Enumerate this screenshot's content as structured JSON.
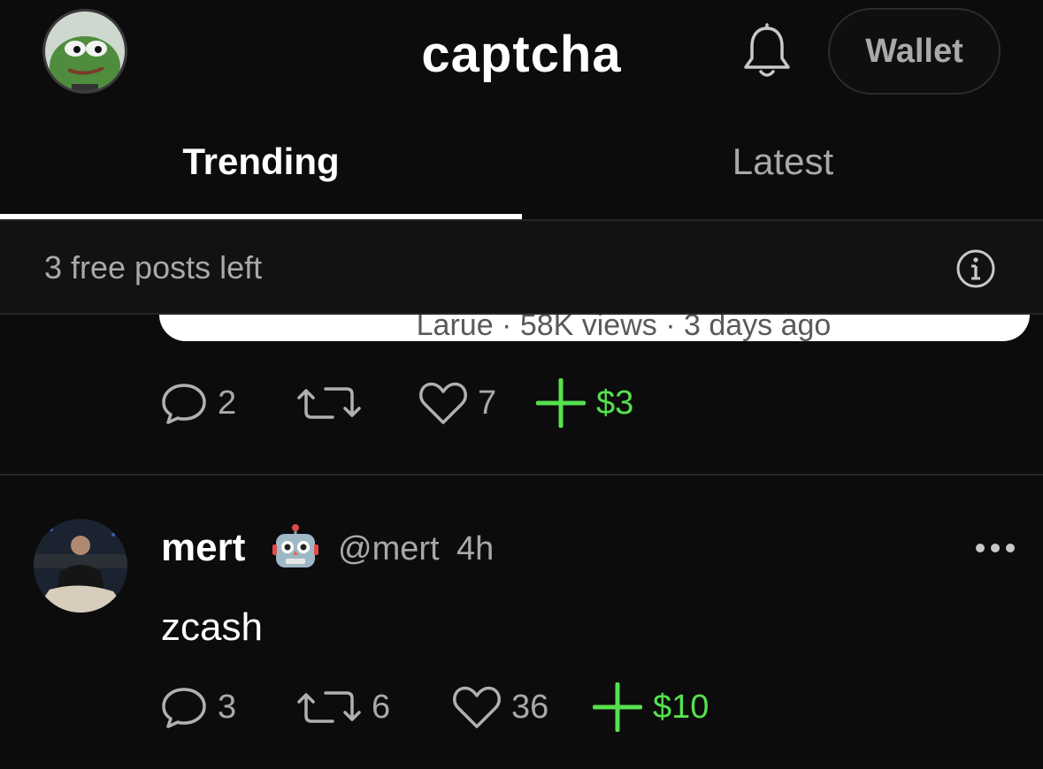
{
  "header": {
    "title": "captcha",
    "wallet_label": "Wallet"
  },
  "tabs": [
    {
      "label": "Trending",
      "active": true
    },
    {
      "label": "Latest",
      "active": false
    }
  ],
  "free_posts": {
    "text": "3 free posts left"
  },
  "embed": {
    "meta": "Larue · 58K views · 3 days ago"
  },
  "previous_post_actions": {
    "replies": "2",
    "reposts": "",
    "likes": "7",
    "tip": "$3"
  },
  "post": {
    "display_name": "mert",
    "handle": "@mert",
    "time": "4h",
    "body": "zcash",
    "actions": {
      "replies": "3",
      "reposts": "6",
      "likes": "36",
      "tip": "$10"
    }
  },
  "colors": {
    "background": "#0c0c0c",
    "accent_green": "#56e04e",
    "muted_text": "#a9a9a9"
  },
  "icons": [
    "bell-icon",
    "info-icon",
    "reply-icon",
    "repost-icon",
    "like-icon",
    "tip-plus-icon",
    "robot-emoji-icon",
    "more-icon"
  ]
}
